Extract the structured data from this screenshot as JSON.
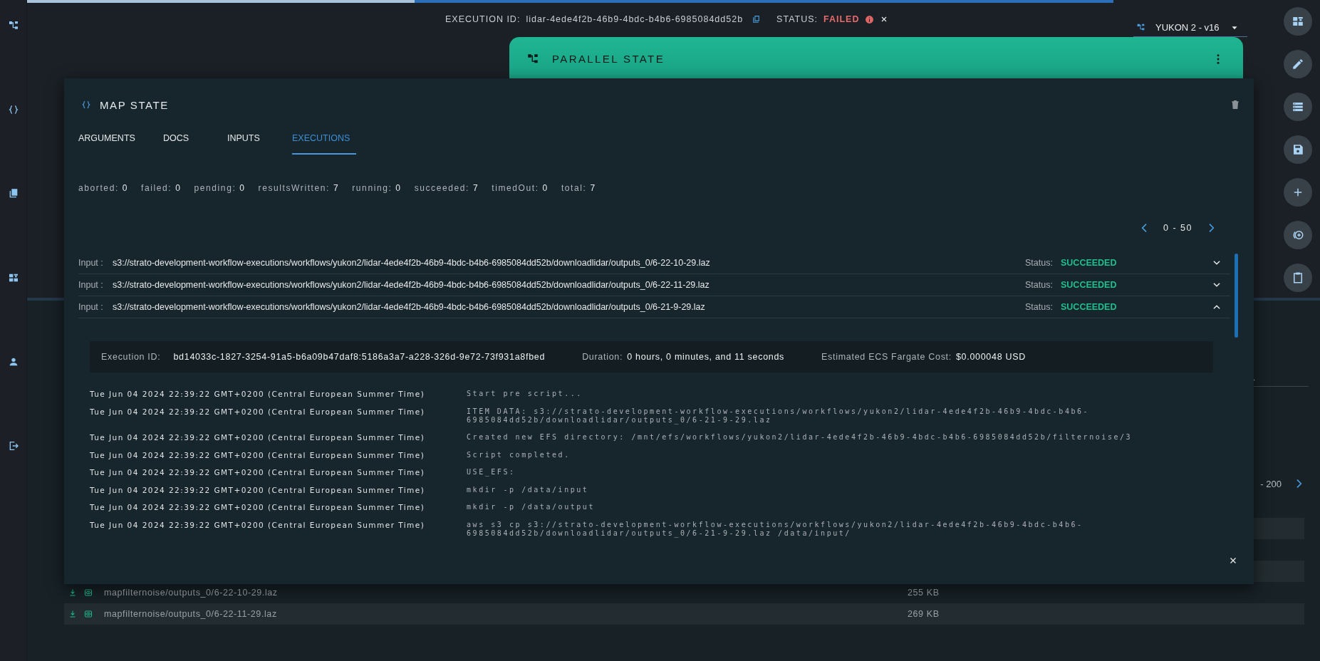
{
  "header": {
    "execution_id_label": "EXECUTION ID:",
    "execution_id": "lidar-4ede4f2b-46b9-4bdc-b4b6-6985084dd52b",
    "status_label": "STATUS:",
    "status": "FAILED"
  },
  "version_select": {
    "value": "YUKON 2 - v16"
  },
  "parallel_state": {
    "title": "PARALLEL STATE"
  },
  "background_panel": {
    "pager_range": "- 200",
    "files": [
      {
        "name": "mapfilternoise/outputs_0/6-22-10-29.laz",
        "size": "255 KB"
      },
      {
        "name": "mapfilternoise/outputs_0/6-22-11-29.laz",
        "size": "269 KB"
      }
    ]
  },
  "modal": {
    "title": "MAP STATE",
    "tabs": [
      {
        "label": "ARGUMENTS",
        "selected": false
      },
      {
        "label": "DOCS",
        "selected": false
      },
      {
        "label": "INPUTS",
        "selected": false
      },
      {
        "label": "EXECUTIONS",
        "selected": true
      }
    ],
    "counts": [
      {
        "label": "aborted:",
        "value": "0"
      },
      {
        "label": "failed:",
        "value": "0"
      },
      {
        "label": "pending:",
        "value": "0"
      },
      {
        "label": "resultsWritten:",
        "value": "7"
      },
      {
        "label": "running:",
        "value": "0"
      },
      {
        "label": "succeeded:",
        "value": "7"
      },
      {
        "label": "timedOut:",
        "value": "0"
      },
      {
        "label": "total:",
        "value": "7"
      }
    ],
    "pager": {
      "range": "0 - 50"
    },
    "executions": [
      {
        "input_label": "Input :",
        "input": "s3://strato-development-workflow-executions/workflows/yukon2/lidar-4ede4f2b-46b9-4bdc-b4b6-6985084dd52b/downloadlidar/outputs_0/6-22-10-29.laz",
        "status_label": "Status:",
        "status": "SUCCEEDED",
        "expanded": false
      },
      {
        "input_label": "Input :",
        "input": "s3://strato-development-workflow-executions/workflows/yukon2/lidar-4ede4f2b-46b9-4bdc-b4b6-6985084dd52b/downloadlidar/outputs_0/6-22-11-29.laz",
        "status_label": "Status:",
        "status": "SUCCEEDED",
        "expanded": false
      },
      {
        "input_label": "Input :",
        "input": "s3://strato-development-workflow-executions/workflows/yukon2/lidar-4ede4f2b-46b9-4bdc-b4b6-6985084dd52b/downloadlidar/outputs_0/6-21-9-29.laz",
        "status_label": "Status:",
        "status": "SUCCEEDED",
        "expanded": true,
        "detail": {
          "execution_id_label": "Execution ID:",
          "execution_id": "bd14033c-1827-3254-91a5-b6a09b47daf8:5186a3a7-a228-326d-9e72-73f931a8fbed",
          "duration_label": "Duration:",
          "duration": "0 hours, 0 minutes, and 11 seconds",
          "cost_label": "Estimated ECS Fargate Cost:",
          "cost": "$0.000048 USD"
        },
        "logs": [
          {
            "time": "Tue Jun 04 2024 22:39:22 GMT+0200 (Central European Summer Time)",
            "message": "Start pre script..."
          },
          {
            "time": "Tue Jun 04 2024 22:39:22 GMT+0200 (Central European Summer Time)",
            "message": "ITEM DATA: s3://strato-development-workflow-executions/workflows/yukon2/lidar-4ede4f2b-46b9-4bdc-b4b6-6985084dd52b/downloadlidar/outputs_0/6-21-9-29.laz"
          },
          {
            "time": "Tue Jun 04 2024 22:39:22 GMT+0200 (Central European Summer Time)",
            "message": "Created new EFS directory: /mnt/efs/workflows/yukon2/lidar-4ede4f2b-46b9-4bdc-b4b6-6985084dd52b/filternoise/3"
          },
          {
            "time": "Tue Jun 04 2024 22:39:22 GMT+0200 (Central European Summer Time)",
            "message": "Script completed."
          },
          {
            "time": "Tue Jun 04 2024 22:39:22 GMT+0200 (Central European Summer Time)",
            "message": "USE_EFS:"
          },
          {
            "time": "Tue Jun 04 2024 22:39:22 GMT+0200 (Central European Summer Time)",
            "message": "mkdir -p /data/input"
          },
          {
            "time": "Tue Jun 04 2024 22:39:22 GMT+0200 (Central European Summer Time)",
            "message": "mkdir -p /data/output"
          },
          {
            "time": "Tue Jun 04 2024 22:39:22 GMT+0200 (Central European Summer Time)",
            "message": "aws s3 cp s3://strato-development-workflow-executions/workflows/yukon2/lidar-4ede4f2b-46b9-4bdc-b4b6-6985084dd52b/downloadlidar/outputs_0/6-21-9-29.laz /data/input/"
          }
        ]
      }
    ]
  }
}
